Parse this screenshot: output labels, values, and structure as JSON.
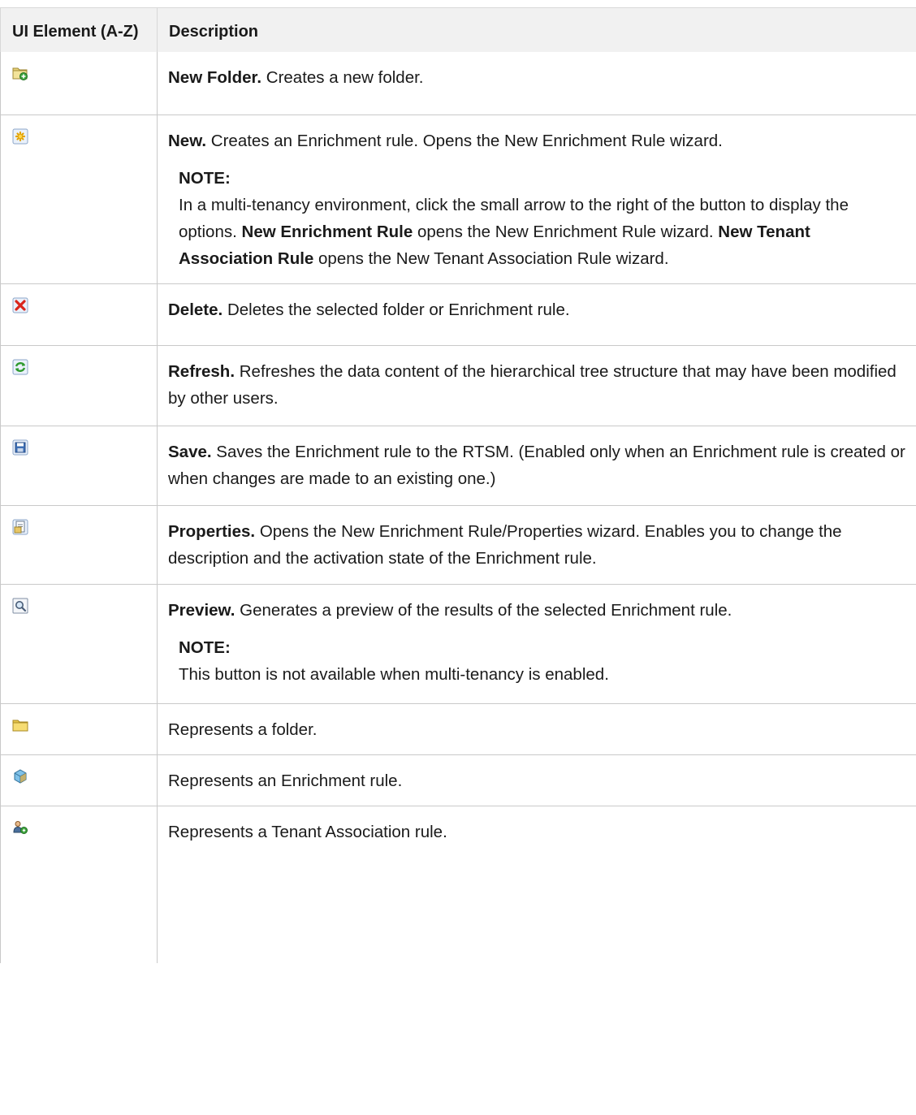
{
  "header": {
    "col1": "UI Element (A-Z)",
    "col2": "Description"
  },
  "rows": [
    {
      "icon": "new-folder-icon",
      "title": "New Folder.",
      "text": "Creates a new folder."
    },
    {
      "icon": "new-icon",
      "title": "New.",
      "text": "Creates an Enrichment rule. Opens the New Enrichment Rule wizard.",
      "note_label": "NOTE:",
      "note": {
        "p1": "In a multi-tenancy environment, click the small arrow to the right of the button to display the options.",
        "b1": "New Enrichment Rule",
        "p2": "opens the New Enrichment Rule wizard.",
        "b2": "New Tenant Association Rule",
        "p3": "opens the New Tenant Association Rule wizard."
      }
    },
    {
      "icon": "delete-icon",
      "title": "Delete.",
      "text": "Deletes the selected folder or Enrichment rule."
    },
    {
      "icon": "refresh-icon",
      "title": "Refresh.",
      "text": "Refreshes the data content of the hierarchical tree structure that may have been modified by other users."
    },
    {
      "icon": "save-icon",
      "title": "Save.",
      "text": "Saves the Enrichment rule to the RTSM. (Enabled only when an Enrichment rule is created or when changes are made to an existing one.)"
    },
    {
      "icon": "properties-icon",
      "title": "Properties.",
      "text": "Opens the New Enrichment Rule/Properties wizard. Enables you to change the description and the activation state of the Enrichment rule."
    },
    {
      "icon": "preview-icon",
      "title": "Preview.",
      "text": "Generates a preview of the results of the selected Enrichment rule.",
      "note_label": "NOTE:",
      "note_text": "This button is not available when multi-tenancy is enabled."
    },
    {
      "icon": "folder-icon",
      "text": "Represents a folder."
    },
    {
      "icon": "enrichment-rule-icon",
      "text": "Represents an Enrichment rule."
    },
    {
      "icon": "tenant-association-rule-icon",
      "text": "Represents a Tenant Association rule."
    }
  ]
}
